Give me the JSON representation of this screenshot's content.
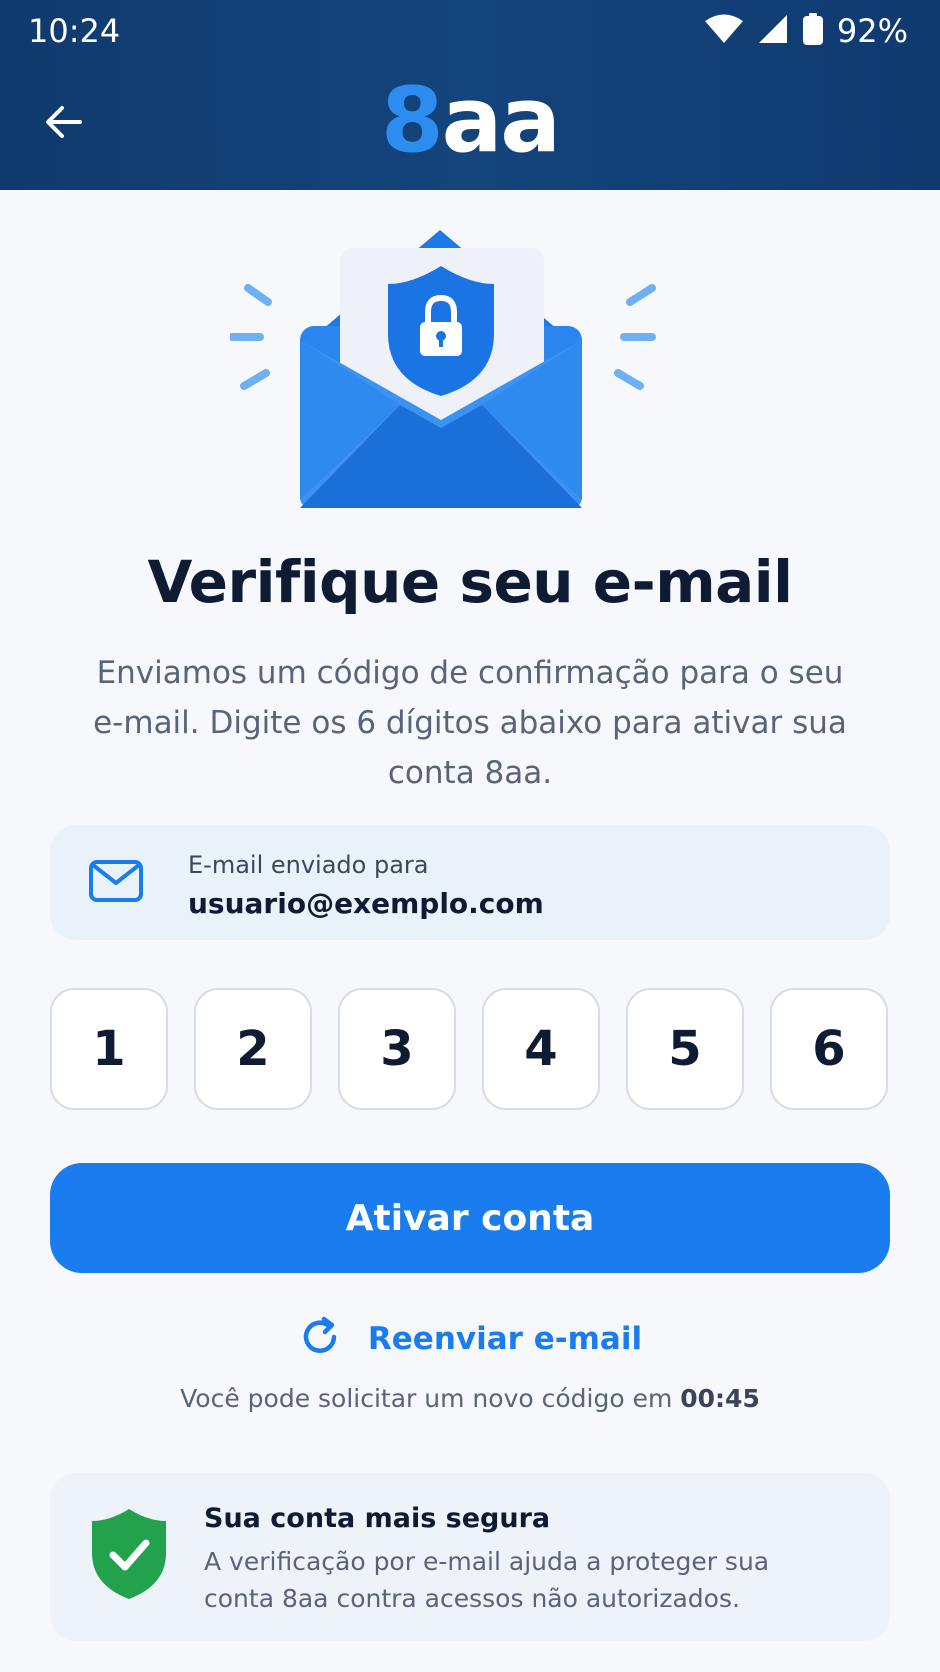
{
  "status_bar": {
    "time": "10:24",
    "battery": "92%"
  },
  "header": {
    "logo_primary": "8",
    "logo_secondary": "aa"
  },
  "hero": {
    "icon": "envelope-shield-lock-icon"
  },
  "title": "Verifique seu e-mail",
  "description": "Enviamos um código de confirmação para o seu e-mail. Digite os 6 dígitos abaixo para ativar sua conta 8aa.",
  "email_card": {
    "label": "E-mail enviado para",
    "address": "usuario@exemplo.com"
  },
  "code": {
    "digits": [
      "1",
      "2",
      "3",
      "4",
      "5",
      "6"
    ]
  },
  "actions": {
    "activate_label": "Ativar conta",
    "resend_label": "Reenviar e-mail",
    "countdown_prefix": "Você pode solicitar um novo código em",
    "countdown_value": "00:45"
  },
  "security_note": {
    "title": "Sua conta mais segura",
    "text": "A verificação por e-mail ajuda a proteger sua conta 8aa contra acessos não autorizados."
  },
  "colors": {
    "header": "#14447c",
    "primary": "#1a7cee",
    "success": "#23a24d",
    "background": "#f6f8fc"
  }
}
